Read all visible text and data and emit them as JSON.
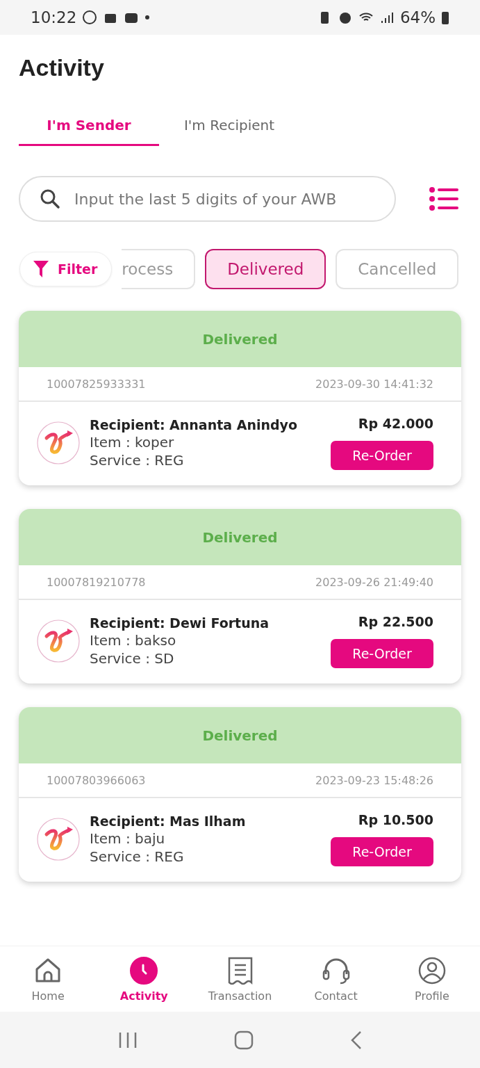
{
  "status_bar": {
    "time": "10:22",
    "battery": "64%"
  },
  "title": "Activity",
  "tabs": [
    {
      "label": "I'm Sender",
      "selected": true
    },
    {
      "label": "I'm Recipient",
      "selected": false
    }
  ],
  "search": {
    "placeholder": "Input the last 5 digits of your AWB"
  },
  "filter": {
    "label": "Filter"
  },
  "chips": [
    {
      "label": "rocess",
      "selected": false,
      "cut": true
    },
    {
      "label": "Delivered",
      "selected": true,
      "cut": false
    },
    {
      "label": "Cancelled",
      "selected": false,
      "cut": false
    }
  ],
  "orders": [
    {
      "status": "Delivered",
      "awb": "10007825933331",
      "date": "2023-09-30 14:41:32",
      "recipient": "Recipient: Annanta Anindyo",
      "item": "Item : koper",
      "service": "Service : REG",
      "price": "Rp 42.000",
      "action": "Re-Order"
    },
    {
      "status": "Delivered",
      "awb": "10007819210778",
      "date": "2023-09-26 21:49:40",
      "recipient": "Recipient: Dewi Fortuna",
      "item": "Item : bakso",
      "service": "Service : SD",
      "price": "Rp 22.500",
      "action": "Re-Order"
    },
    {
      "status": "Delivered",
      "awb": "10007803966063",
      "date": "2023-09-23 15:48:26",
      "recipient": "Recipient: Mas Ilham",
      "item": "Item : baju",
      "service": "Service : REG",
      "price": "Rp 10.500",
      "action": "Re-Order"
    }
  ],
  "nav": [
    {
      "kind": "home",
      "label": "Home",
      "selected": false
    },
    {
      "kind": "activity",
      "label": "Activity",
      "selected": true
    },
    {
      "kind": "transaction",
      "label": "Transaction",
      "selected": false
    },
    {
      "kind": "contact",
      "label": "Contact",
      "selected": false
    },
    {
      "kind": "profile",
      "label": "Profile",
      "selected": false
    }
  ]
}
